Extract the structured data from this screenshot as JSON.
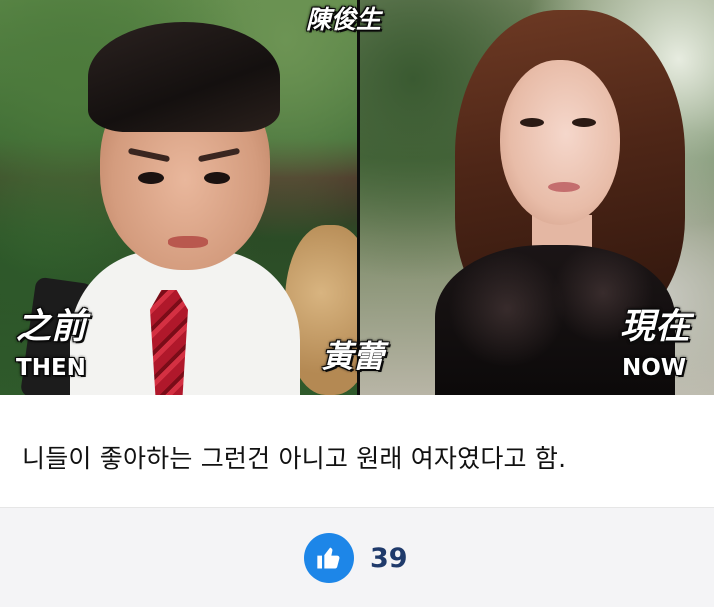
{
  "photo": {
    "top_name": "陳俊生",
    "then_label_cn": "之前",
    "then_label_en": "THEN",
    "now_name": "黃蕾",
    "now_label_cn": "現在",
    "now_label_en": "NOW"
  },
  "caption": {
    "text": "니들이 좋아하는 그런건 아니고 원래 여자였다고 함."
  },
  "reactions": {
    "like_icon": "thumbs-up-icon",
    "like_count": "39",
    "like_color": "#1d86e8",
    "count_color": "#1f3a6b"
  }
}
